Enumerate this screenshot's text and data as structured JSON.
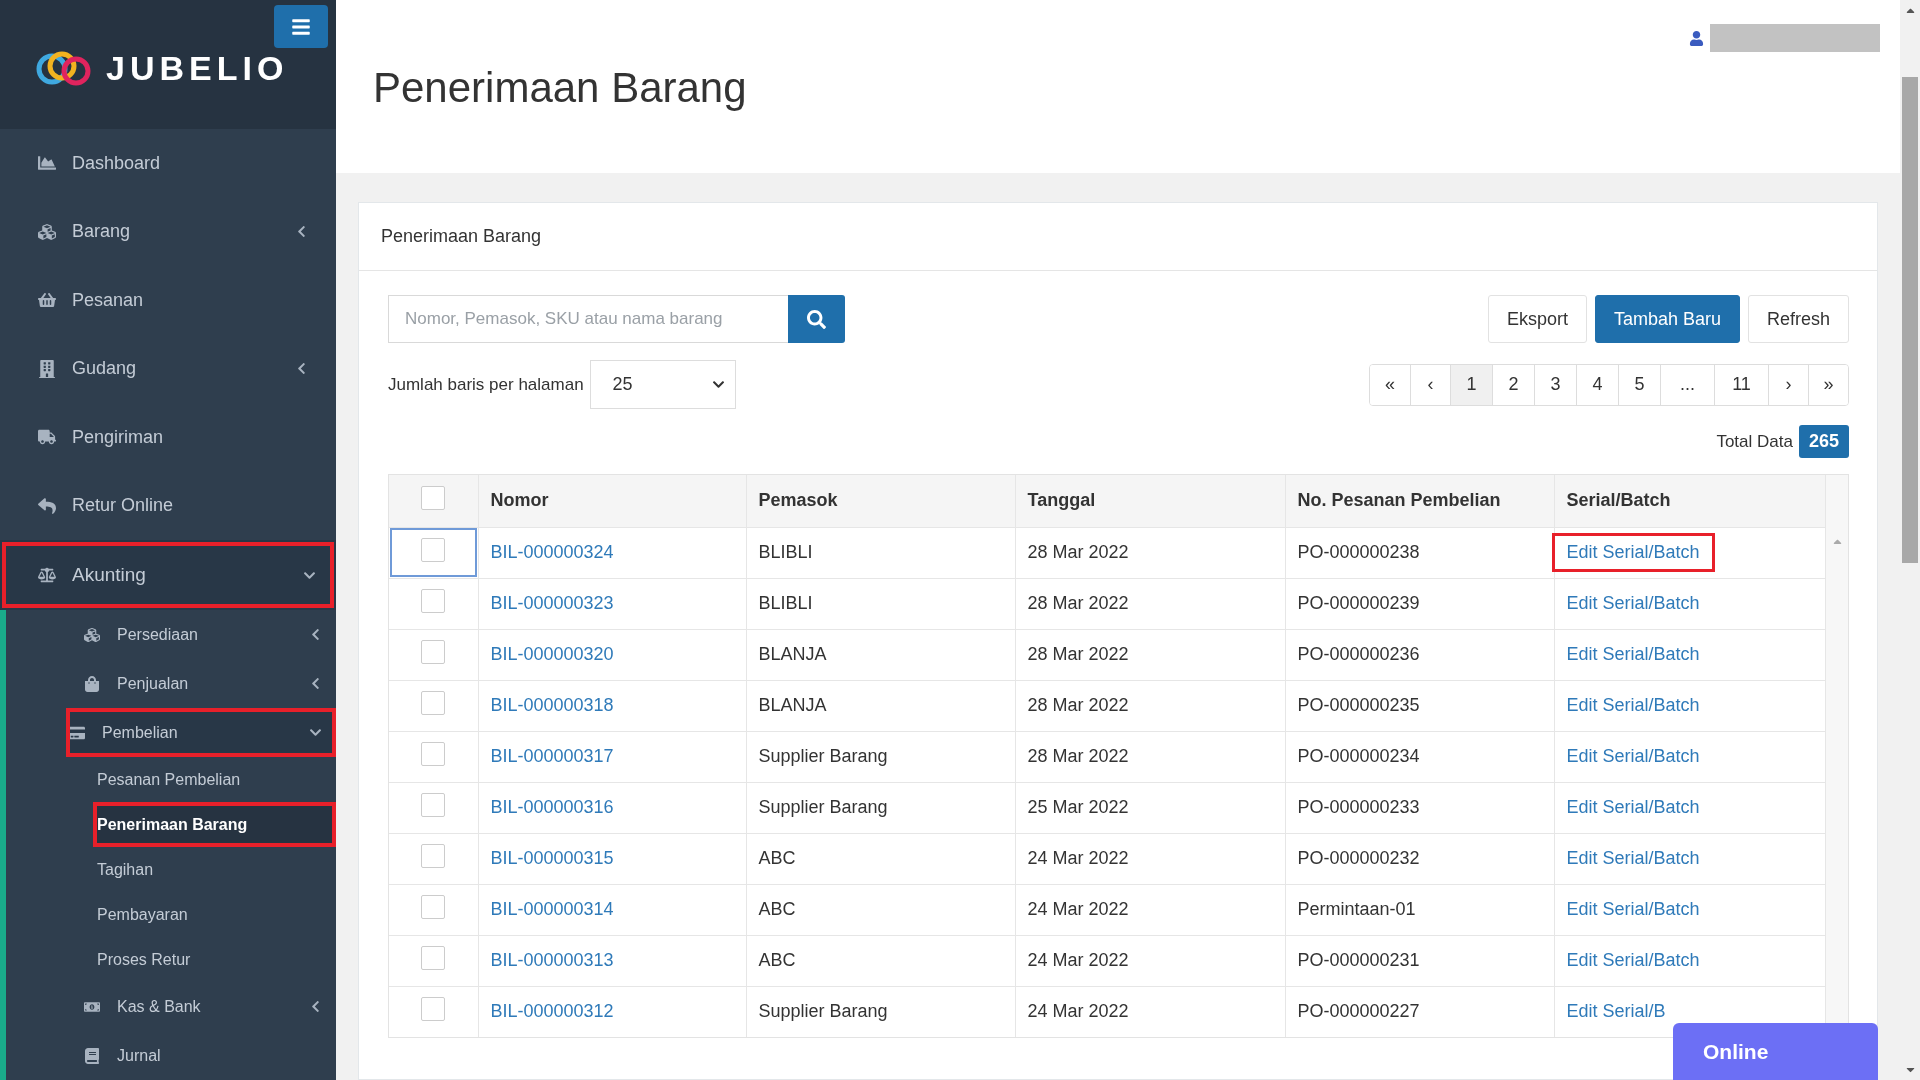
{
  "sidebar": {
    "logo_text": "JUBELIO",
    "items": [
      {
        "label": "Dashboard",
        "highlighted": false
      },
      {
        "label": "Barang",
        "expanded": false,
        "highlighted": false
      },
      {
        "label": "Pesanan",
        "highlighted": false
      },
      {
        "label": "Gudang",
        "expanded": false,
        "highlighted": false
      },
      {
        "label": "Pengiriman",
        "highlighted": false
      },
      {
        "label": "Retur Online",
        "highlighted": false
      },
      {
        "label": "Akunting",
        "expanded": true,
        "highlighted": true,
        "children": [
          {
            "label": "Persediaan",
            "expanded": false,
            "highlighted": false
          },
          {
            "label": "Penjualan",
            "expanded": false,
            "highlighted": false
          },
          {
            "label": "Pembelian",
            "expanded": true,
            "highlighted": true,
            "children": [
              {
                "label": "Pesanan Pembelian",
                "selected": false,
                "highlighted": false
              },
              {
                "label": "Penerimaan Barang",
                "selected": true,
                "highlighted": true
              },
              {
                "label": "Tagihan",
                "selected": false,
                "highlighted": false
              },
              {
                "label": "Pembayaran",
                "selected": false,
                "highlighted": false
              },
              {
                "label": "Proses Retur",
                "selected": false,
                "highlighted": false
              }
            ]
          },
          {
            "label": "Kas & Bank",
            "expanded": false,
            "highlighted": false
          },
          {
            "label": "Jurnal",
            "highlighted": false
          }
        ]
      }
    ]
  },
  "page_title": "Penerimaan Barang",
  "card": {
    "title": "Penerimaan Barang",
    "search": {
      "placeholder": "Nomor, Pemasok, SKU atau nama barang"
    },
    "buttons": [
      {
        "label": "Eksport",
        "kind": "default"
      },
      {
        "label": "Tambah Baru",
        "kind": "primary"
      },
      {
        "label": "Refresh",
        "kind": "default"
      }
    ],
    "rows_per_page": {
      "label": "Jumlah baris per halaman",
      "value": "25"
    },
    "pagination": [
      {
        "label": "«",
        "selected": false
      },
      {
        "label": "‹",
        "selected": false
      },
      {
        "label": "1",
        "selected": true
      },
      {
        "label": "2",
        "selected": false
      },
      {
        "label": "3",
        "selected": false
      },
      {
        "label": "4",
        "selected": false
      },
      {
        "label": "5",
        "selected": false
      },
      {
        "label": "...",
        "selected": false
      },
      {
        "label": "11",
        "selected": false
      },
      {
        "label": "›",
        "selected": false
      },
      {
        "label": "»",
        "selected": false
      }
    ],
    "total": {
      "label": "Total Data",
      "value": "265"
    },
    "table": {
      "header_checked": false,
      "columns": [
        "Nomor",
        "Pemasok",
        "Tanggal",
        "No. Pesanan Pembelian",
        "Serial/Batch"
      ],
      "rows": [
        {
          "nomor": "BIL-000000324",
          "pemasok": "BLIBLI",
          "tanggal": "28 Mar 2022",
          "po": "PO-000000238",
          "action": "Edit Serial/Batch",
          "checked": false,
          "focused": true,
          "highlighted": true
        },
        {
          "nomor": "BIL-000000323",
          "pemasok": "BLIBLI",
          "tanggal": "28 Mar 2022",
          "po": "PO-000000239",
          "action": "Edit Serial/Batch",
          "checked": false,
          "focused": false,
          "highlighted": false
        },
        {
          "nomor": "BIL-000000320",
          "pemasok": "BLANJA",
          "tanggal": "28 Mar 2022",
          "po": "PO-000000236",
          "action": "Edit Serial/Batch",
          "checked": false,
          "focused": false,
          "highlighted": false
        },
        {
          "nomor": "BIL-000000318",
          "pemasok": "BLANJA",
          "tanggal": "28 Mar 2022",
          "po": "PO-000000235",
          "action": "Edit Serial/Batch",
          "checked": false,
          "focused": false,
          "highlighted": false
        },
        {
          "nomor": "BIL-000000317",
          "pemasok": "Supplier Barang",
          "tanggal": "28 Mar 2022",
          "po": "PO-000000234",
          "action": "Edit Serial/Batch",
          "checked": false,
          "focused": false,
          "highlighted": false
        },
        {
          "nomor": "BIL-000000316",
          "pemasok": "Supplier Barang",
          "tanggal": "25 Mar 2022",
          "po": "PO-000000233",
          "action": "Edit Serial/Batch",
          "checked": false,
          "focused": false,
          "highlighted": false
        },
        {
          "nomor": "BIL-000000315",
          "pemasok": "ABC",
          "tanggal": "24 Mar 2022",
          "po": "PO-000000232",
          "action": "Edit Serial/Batch",
          "checked": false,
          "focused": false,
          "highlighted": false
        },
        {
          "nomor": "BIL-000000314",
          "pemasok": "ABC",
          "tanggal": "24 Mar 2022",
          "po": "Permintaan-01",
          "action": "Edit Serial/Batch",
          "checked": false,
          "focused": false,
          "highlighted": false
        },
        {
          "nomor": "BIL-000000313",
          "pemasok": "ABC",
          "tanggal": "24 Mar 2022",
          "po": "PO-000000231",
          "action": "Edit Serial/Batch",
          "checked": false,
          "focused": false,
          "highlighted": false
        },
        {
          "nomor": "BIL-000000312",
          "pemasok": "Supplier Barang",
          "tanggal": "24 Mar 2022",
          "po": "PO-000000227",
          "action": "Edit Serial/B",
          "checked": false,
          "focused": false,
          "highlighted": false
        }
      ]
    }
  },
  "chat_widget": {
    "label": "Online"
  }
}
